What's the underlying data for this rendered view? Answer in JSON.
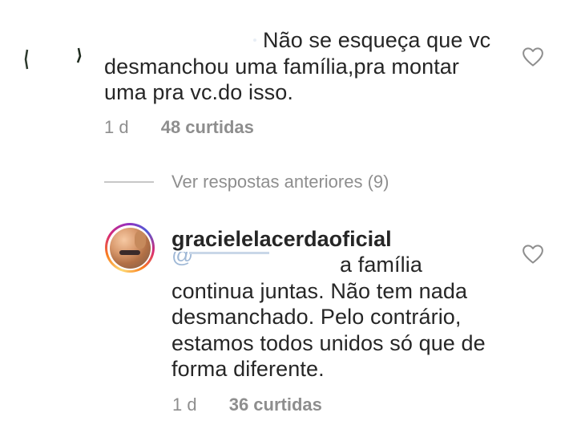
{
  "comment1": {
    "text_lines": [
      "Não se esqueça que vc",
      "desmanchou uma família,pra montar",
      "uma pra vc.do isso."
    ],
    "time": "1 d",
    "likes": "48 curtidas"
  },
  "replies_toggle": {
    "label": "Ver respostas anteriores (9)"
  },
  "comment2": {
    "username": "gracielelacerdaoficial",
    "mention_partial": "@",
    "text_first_tail": "a família",
    "text_lines": [
      "continua juntas. Não tem nada",
      "desmanchado. Pelo contrário,",
      "estamos todos unidos só que de",
      "forma diferente."
    ],
    "time": "1 d",
    "likes": "36 curtidas"
  },
  "icons": {
    "like1": "heart-outline-icon",
    "like2": "heart-outline-icon"
  },
  "colors": {
    "text": "#262626",
    "secondary": "#8e8e8e",
    "mention": "#00376b"
  }
}
